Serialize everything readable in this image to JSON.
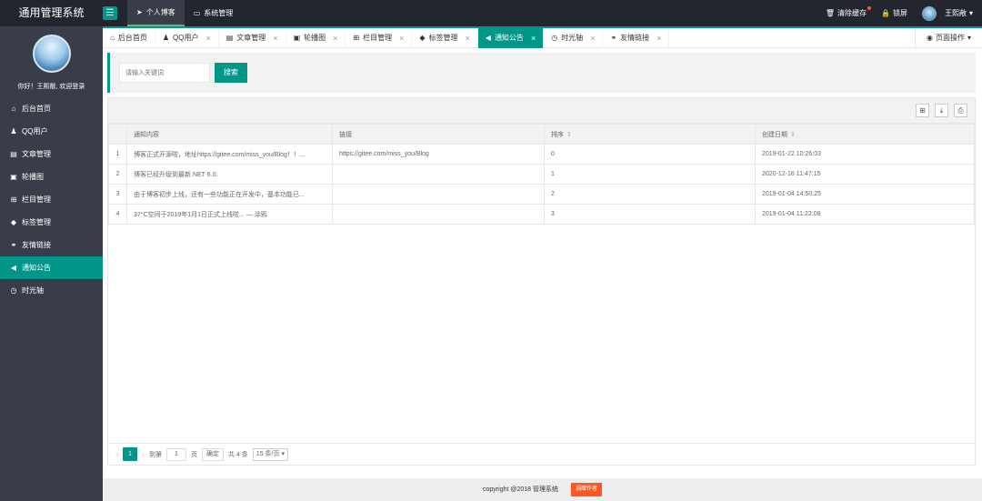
{
  "header": {
    "logo": "通用管理系统",
    "nav": [
      {
        "label": "个人博客",
        "icon": "send-icon"
      },
      {
        "label": "系统管理",
        "icon": "monitor-icon"
      }
    ],
    "clear_cache": "清除缓存",
    "lock": "锁屏",
    "username": "王熙敞"
  },
  "sidebar": {
    "welcome": "你好！王熙敞, 欢迎登录",
    "items": [
      {
        "label": "后台首页",
        "icon": "home-icon"
      },
      {
        "label": "QQ用户",
        "icon": "qq-icon"
      },
      {
        "label": "文章管理",
        "icon": "file-icon"
      },
      {
        "label": "轮播图",
        "icon": "image-icon"
      },
      {
        "label": "栏目管理",
        "icon": "sitemap-icon"
      },
      {
        "label": "标签管理",
        "icon": "tag-icon"
      },
      {
        "label": "友情链接",
        "icon": "link-icon"
      },
      {
        "label": "通知公告",
        "icon": "volume-icon"
      },
      {
        "label": "时光轴",
        "icon": "clock-icon"
      }
    ],
    "active_index": 7
  },
  "tabs": {
    "items": [
      {
        "label": "后台首页",
        "icon": "home-icon",
        "closable": false
      },
      {
        "label": "QQ用户",
        "icon": "qq-icon",
        "closable": true
      },
      {
        "label": "文章管理",
        "icon": "file-icon",
        "closable": true
      },
      {
        "label": "轮播图",
        "icon": "image-icon",
        "closable": true
      },
      {
        "label": "栏目管理",
        "icon": "sitemap-icon",
        "closable": true
      },
      {
        "label": "标签管理",
        "icon": "tag-icon",
        "closable": true
      },
      {
        "label": "通知公告",
        "icon": "volume-icon",
        "closable": true
      },
      {
        "label": "时光轴",
        "icon": "clock-icon",
        "closable": true
      },
      {
        "label": "友情链接",
        "icon": "link-icon",
        "closable": true
      }
    ],
    "active_index": 6,
    "page_op": "页面操作"
  },
  "search": {
    "placeholder": "请输入关键词",
    "button": "搜索"
  },
  "table": {
    "headers": [
      "通知内容",
      "链接",
      "排序",
      "创建日期"
    ],
    "rows": [
      {
        "idx": "1",
        "content": "博客正式开源啦，地址https://gitee.com/miss_you/Blog！！...",
        "link": "https://gitee.com/miss_you/Blog",
        "sort": "0",
        "date": "2019-01-22 10:26:03"
      },
      {
        "idx": "2",
        "content": "博客已经升级到最新.NET 6.0.",
        "link": "",
        "sort": "1",
        "date": "2020-12-16 11:47:15"
      },
      {
        "idx": "3",
        "content": "由于博客初步上线，还有一些功能正在开发中，基本功能已...",
        "link": "",
        "sort": "2",
        "date": "2019-01-04 14:50:25"
      },
      {
        "idx": "4",
        "content": "37°C空间于2019年1月1日正式上线啦... — 涂鸦",
        "link": "",
        "sort": "3",
        "date": "2019-01-04 11:22:08"
      }
    ]
  },
  "pager": {
    "current": "1",
    "goto_label": "到第",
    "goto_value": "1",
    "page_unit": "页",
    "confirm": "确定",
    "total": "共 4 条",
    "page_size": "15 条/页"
  },
  "footer": {
    "copyright": "copyright @2018 管理系统",
    "donate": "捐赠作者"
  },
  "colors": {
    "accent": "#009688",
    "dark": "#23262e",
    "sidebar": "#393d49",
    "warning": "#ff5722"
  }
}
